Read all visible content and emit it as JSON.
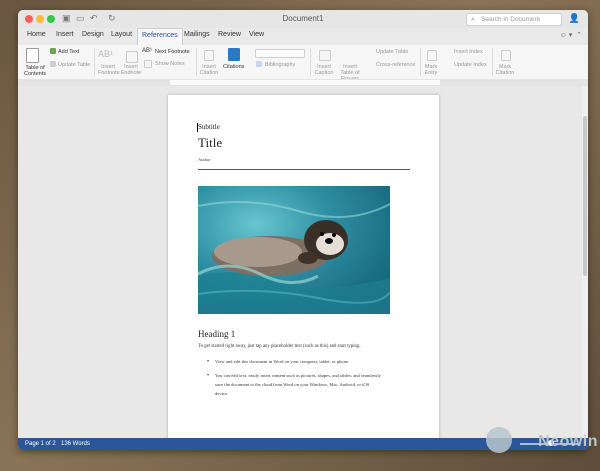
{
  "window": {
    "title": "Document1",
    "search_placeholder": "Search in Document",
    "quick_access": [
      "save-icon",
      "open-icon",
      "undo-icon",
      "redo-icon"
    ]
  },
  "tabs": [
    "Home",
    "Insert",
    "Design",
    "Layout",
    "References",
    "Mailings",
    "Review",
    "View"
  ],
  "active_tab": "References",
  "ribbon": {
    "table_of_contents": "Table of Contents",
    "add_text": "Add Text",
    "update_table": "Update Table",
    "insert_footnote": "Insert Footnote",
    "insert_endnote": "Insert Endnote",
    "next_footnote": "Next Footnote",
    "show_notes": "Show Notes",
    "insert_citation": "Insert Citation",
    "citations": "Citations",
    "bibliography": "Bibliography",
    "insert_caption": "Insert Caption",
    "insert_table_of_figures": "Insert Table of Figures",
    "update_table_2": "Update Table",
    "cross_reference": "Cross-reference",
    "mark_entry": "Mark Entry",
    "insert_index": "Insert Index",
    "update_index": "Update Index",
    "mark_citation": "Mark Citation"
  },
  "document": {
    "subtitle": "Subtitle",
    "title": "Title",
    "author": "Author",
    "heading": "Heading 1",
    "body": "To get started right away, just tap any placeholder text (such as this) and start typing.",
    "bullets": [
      "View and edit this document in Word on your computer, tablet, or phone.",
      "You can edit text; easily insert content such as pictures, shapes, and tables; and seamlessly",
      "save the document to the cloud from Word on your Windows, Mac, Android, or iOS",
      "device."
    ]
  },
  "status": {
    "page": "Page 1 of 2",
    "words": "136 Words"
  },
  "watermark": "Neowin",
  "colors": {
    "accent": "#2b579a",
    "close": "#fc605c",
    "minimize": "#fdbc40",
    "maximize": "#34c84a"
  }
}
